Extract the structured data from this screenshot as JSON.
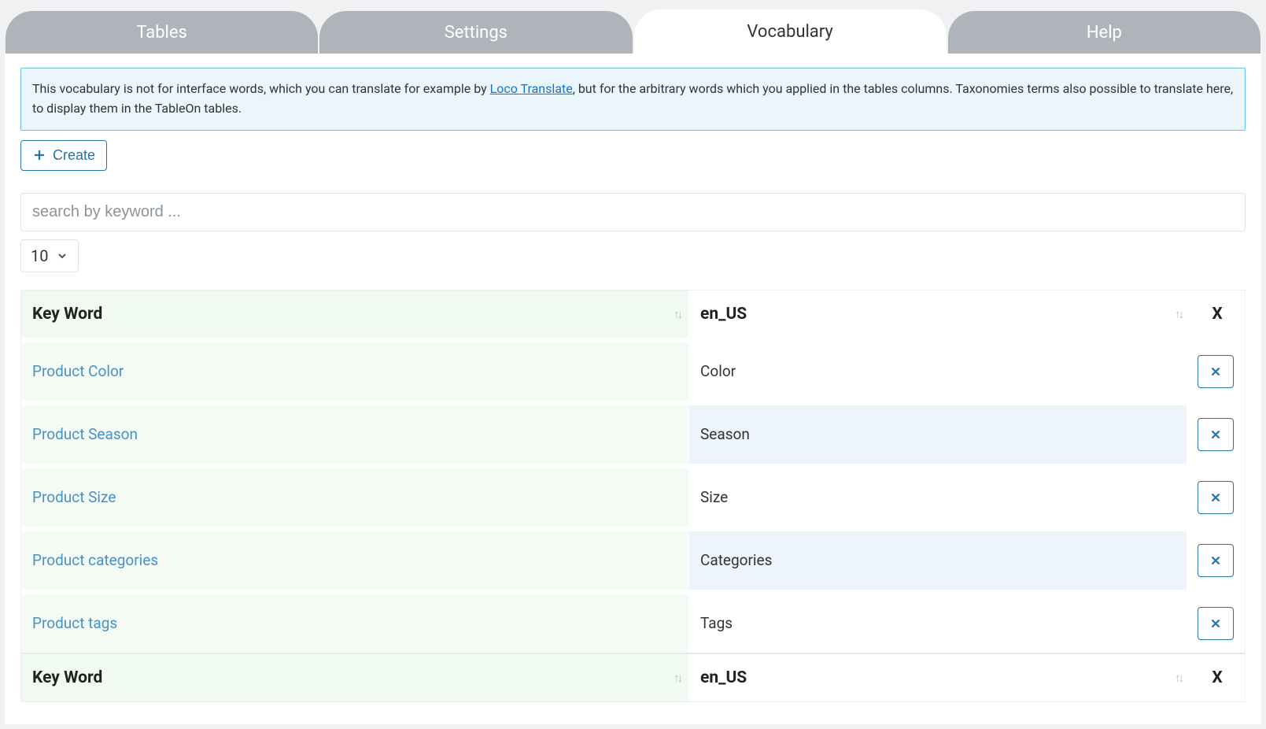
{
  "tabs": {
    "items": [
      {
        "label": "Tables",
        "active": false
      },
      {
        "label": "Settings",
        "active": false
      },
      {
        "label": "Vocabulary",
        "active": true
      },
      {
        "label": "Help",
        "active": false
      }
    ]
  },
  "info": {
    "pre": "This vocabulary is not for interface words, which you can translate for example by ",
    "link": "Loco Translate",
    "post": ", but for the arbitrary words which you applied in the tables columns. Taxonomies terms also possible to translate here, to display them in the TableOn tables."
  },
  "toolbar": {
    "create_label": "Create"
  },
  "search": {
    "placeholder": "search by keyword ..."
  },
  "page_size": {
    "value": "10"
  },
  "table": {
    "headers": {
      "key": "Key Word",
      "en": "en_US",
      "x": "X"
    },
    "rows": [
      {
        "key": "Product Color",
        "en": "Color"
      },
      {
        "key": "Product Season",
        "en": "Season"
      },
      {
        "key": "Product Size",
        "en": "Size"
      },
      {
        "key": "Product categories",
        "en": "Categories"
      },
      {
        "key": "Product tags",
        "en": "Tags"
      }
    ]
  }
}
